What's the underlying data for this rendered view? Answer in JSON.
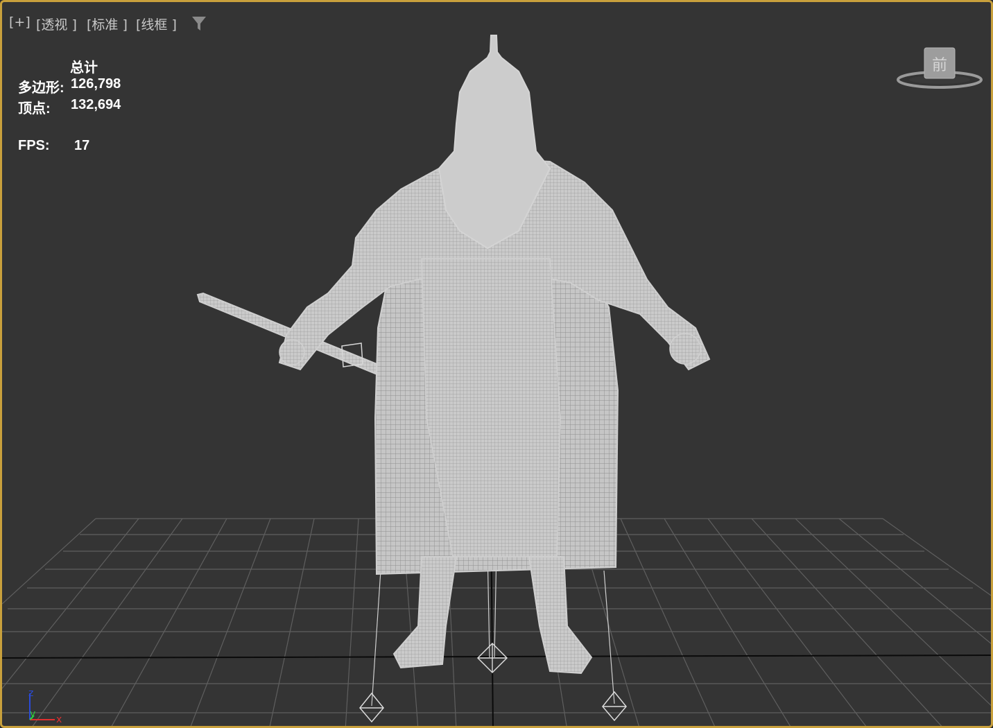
{
  "viewport": {
    "labels": [
      "[+]",
      "[透视 ]",
      "[标准 ]",
      "[线框 ]"
    ],
    "filter_icon": "filter-funnel-icon"
  },
  "stats": {
    "header": "总计",
    "polygons_label": "多边形:",
    "polygons_value": "126,798",
    "vertices_label": "顶点:",
    "vertices_value": "132,694",
    "fps_label": "FPS:",
    "fps_value": "17"
  },
  "viewcube": {
    "face_label": "前",
    "icon": "viewcube-icon"
  },
  "axis_tripod": {
    "z": "z",
    "y": "y",
    "x": "x"
  },
  "colors": {
    "viewport_border": "#c8a03c",
    "viewport_bg": "#343434",
    "grid_line": "#5a5a5a",
    "grid_axis": "#000000",
    "wireframe": "#d0d0d0",
    "axis_z": "#2a4bd8",
    "axis_y": "#2ecc40",
    "axis_x": "#e03030"
  }
}
